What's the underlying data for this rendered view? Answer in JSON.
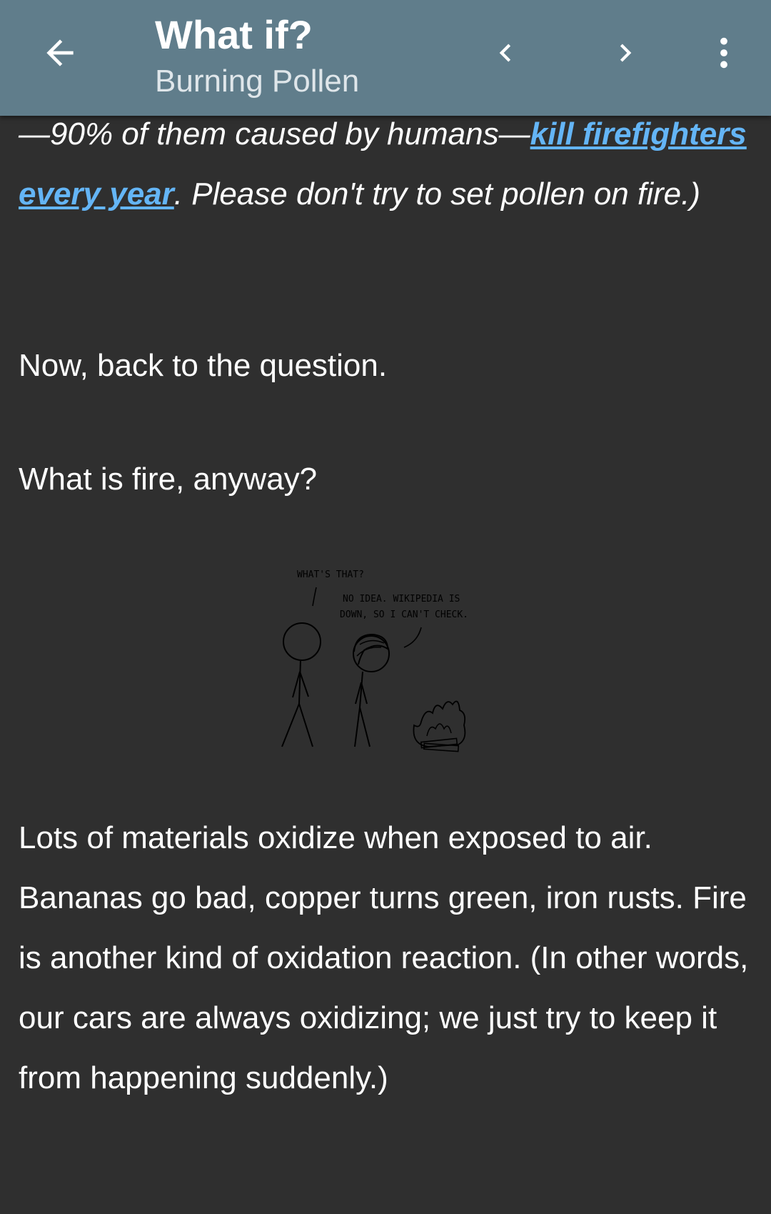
{
  "toolbar": {
    "title": "What if?",
    "subtitle": "Burning Pollen",
    "back_icon": "arrow-left-icon",
    "prev_icon": "chevron-left-icon",
    "next_icon": "chevron-right-icon",
    "menu_icon": "more-vertical-icon"
  },
  "article": {
    "p1_before": "—90% of them caused by humans—",
    "p1_link": "kill firefighters every year",
    "p1_after": ". Please don't try to set pollen on fire.)",
    "p2": "Now, back to the question.",
    "p3": "What is fire, anyway?",
    "comic": {
      "caption1": "WHAT'S THAT?",
      "caption2_line1": "NO IDEA.  WIKIPEDIA IS",
      "caption2_line2": "DOWN, SO I CAN'T CHECK."
    },
    "p4": "Lots of materials oxidize when exposed to air. Bananas go bad, copper turns green, iron rusts. Fire is another kind of oxidation reaction. (In other words, our cars are always oxidizing; we just try to keep it from happening suddenly.)"
  },
  "colors": {
    "toolbar": "#607d8b",
    "background": "#2f2f2f",
    "link": "#64b5f6",
    "text": "#ffffff"
  }
}
